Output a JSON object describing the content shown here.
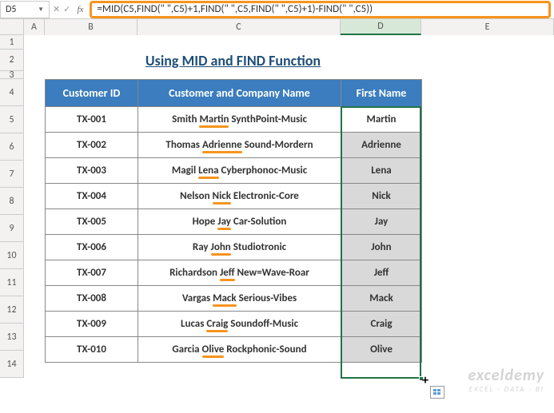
{
  "nameBox": "D5",
  "formula": "=MID(C5,FIND(\" \",C5)+1,FIND(\" \",C5,FIND(\" \",C5)+1)-FIND(\" \",C5))",
  "columns": [
    "A",
    "B",
    "C",
    "D",
    "E"
  ],
  "title": "Using MID and FIND Function",
  "headers": {
    "id": "Customer ID",
    "comp": "Customer and Company Name",
    "first": "First Name"
  },
  "rows": [
    {
      "num": 5,
      "id": "TX-001",
      "pre": "Smith ",
      "mid": "Martin",
      "post": " SynthPoint-Music",
      "first": "Martin"
    },
    {
      "num": 6,
      "id": "TX-002",
      "pre": "Thomas ",
      "mid": "Adrienne",
      "post": " Sound-Mordern",
      "first": "Adrienne"
    },
    {
      "num": 7,
      "id": "TX-003",
      "pre": "Magil ",
      "mid": "Lena",
      "post": " Cyberphonoc-Music",
      "first": "Lena"
    },
    {
      "num": 8,
      "id": "TX-004",
      "pre": "Nelson ",
      "mid": "Nick",
      "post": " Electronic-Core",
      "first": "Nick"
    },
    {
      "num": 9,
      "id": "TX-005",
      "pre": "Hope ",
      "mid": "Jay",
      "post": " Car-Solution",
      "first": "Jay"
    },
    {
      "num": 10,
      "id": "TX-006",
      "pre": "Ray ",
      "mid": "John",
      "post": " Studiotronic",
      "first": "John"
    },
    {
      "num": 11,
      "id": "TX-007",
      "pre": "Richardson ",
      "mid": "Jeff",
      "post": " New=Wave-Roar",
      "first": "Jeff"
    },
    {
      "num": 12,
      "id": "TX-008",
      "pre": "Vargas ",
      "mid": "Mack",
      "post": " Serious-Vibes",
      "first": "Mack"
    },
    {
      "num": 13,
      "id": "TX-009",
      "pre": "Lucas ",
      "mid": "Craig",
      "post": " Soundoff-Music",
      "first": "Craig"
    },
    {
      "num": 14,
      "id": "TX-010",
      "pre": "Garcia ",
      "mid": "Olive",
      "post": " Rockphonic-Sound",
      "first": "Olive"
    }
  ],
  "watermark": {
    "main": "exceldemy",
    "sub": "EXCEL · DATA · BI"
  }
}
